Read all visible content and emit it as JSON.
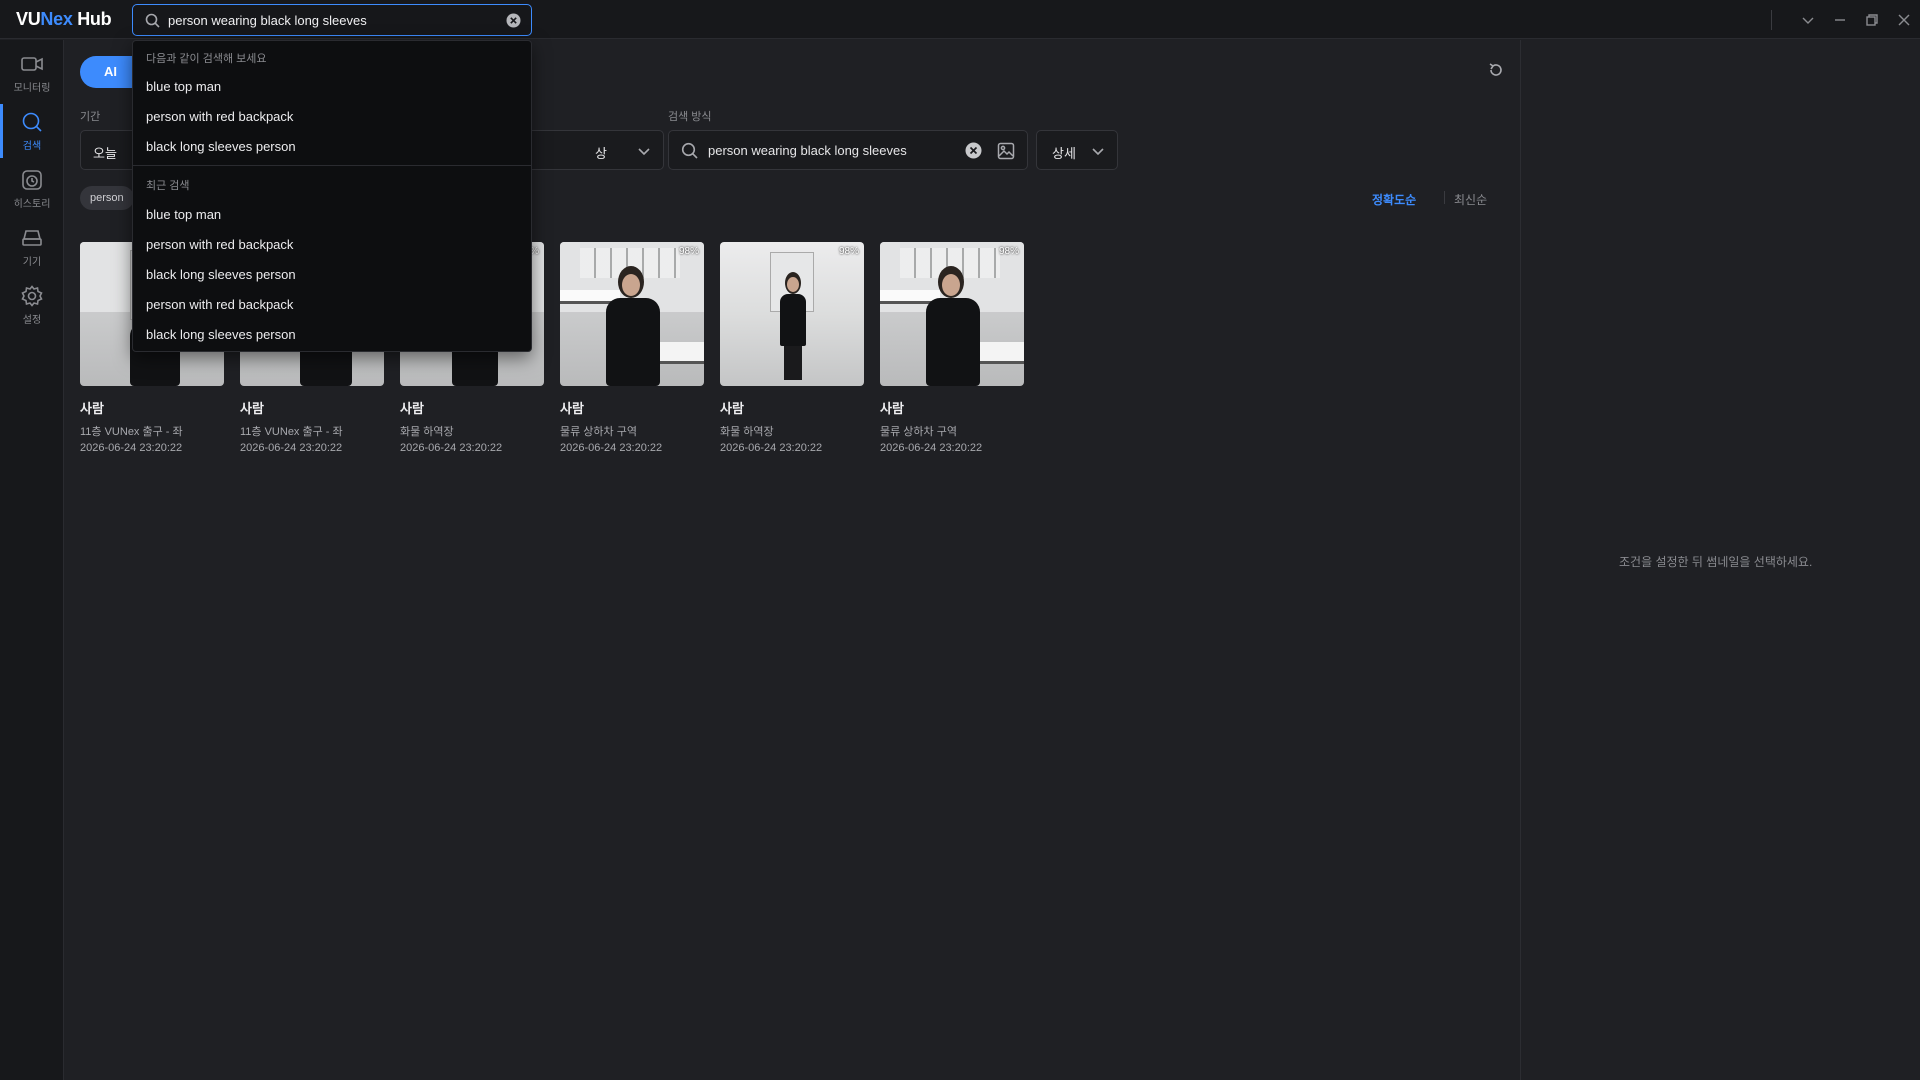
{
  "app": {
    "logo_prefix": "VU",
    "logo_accent": "Nex",
    "logo_suffix": " Hub",
    "accent_color": "#3d8bfd"
  },
  "top_search": {
    "value": "person wearing black long sleeves",
    "icon": "search-icon"
  },
  "sidebar": {
    "items": [
      {
        "label": "모니터링",
        "icon": "video-camera-icon",
        "active": false
      },
      {
        "label": "검색",
        "icon": "search-icon",
        "active": true
      },
      {
        "label": "히스토리",
        "icon": "history-clock-icon",
        "active": false
      },
      {
        "label": "기기",
        "icon": "device-storage-icon",
        "active": false
      },
      {
        "label": "설정",
        "icon": "gear-icon",
        "active": false
      }
    ]
  },
  "filters": {
    "ai_label": "AI",
    "period_label": "기간",
    "period_value": "오늘",
    "target_value_partial": "상",
    "method_label": "검색 방식",
    "method_value": "person wearing black long sleeves",
    "detail_label": "상세",
    "chip_partial": "person"
  },
  "sort": {
    "accuracy": "정확도순",
    "latest": "최신순"
  },
  "results": [
    {
      "title": "사람",
      "location": "11층 VUNex 출구 - 좌",
      "time": "2026-06-24 23:20:22",
      "score": ""
    },
    {
      "title": "사람",
      "location": "11층 VUNex 출구 - 좌",
      "time": "2026-06-24 23:20:22",
      "score": ""
    },
    {
      "title": "사람",
      "location": "화물 하역장",
      "time": "2026-06-24 23:20:22",
      "score": "%"
    },
    {
      "title": "사람",
      "location": "물류 상하차 구역",
      "time": "2026-06-24 23:20:22",
      "score": "98%"
    },
    {
      "title": "사람",
      "location": "화물 하역장",
      "time": "2026-06-24 23:20:22",
      "score": "98%"
    },
    {
      "title": "사람",
      "location": "물류 상하차 구역",
      "time": "2026-06-24 23:20:22",
      "score": "98%"
    }
  ],
  "right_panel": {
    "hint": "조건을 설정한 뒤 썸네일을 선택하세요."
  },
  "dropdown": {
    "suggest_header": "다음과 같이 검색해 보세요",
    "suggestions": [
      "blue top man",
      "person with red backpack",
      "black long sleeves person"
    ],
    "recent_header": "최근 검색",
    "recent": [
      "blue top man",
      "person with red backpack",
      "black long sleeves person",
      "person with red backpack",
      "black long sleeves person"
    ]
  }
}
